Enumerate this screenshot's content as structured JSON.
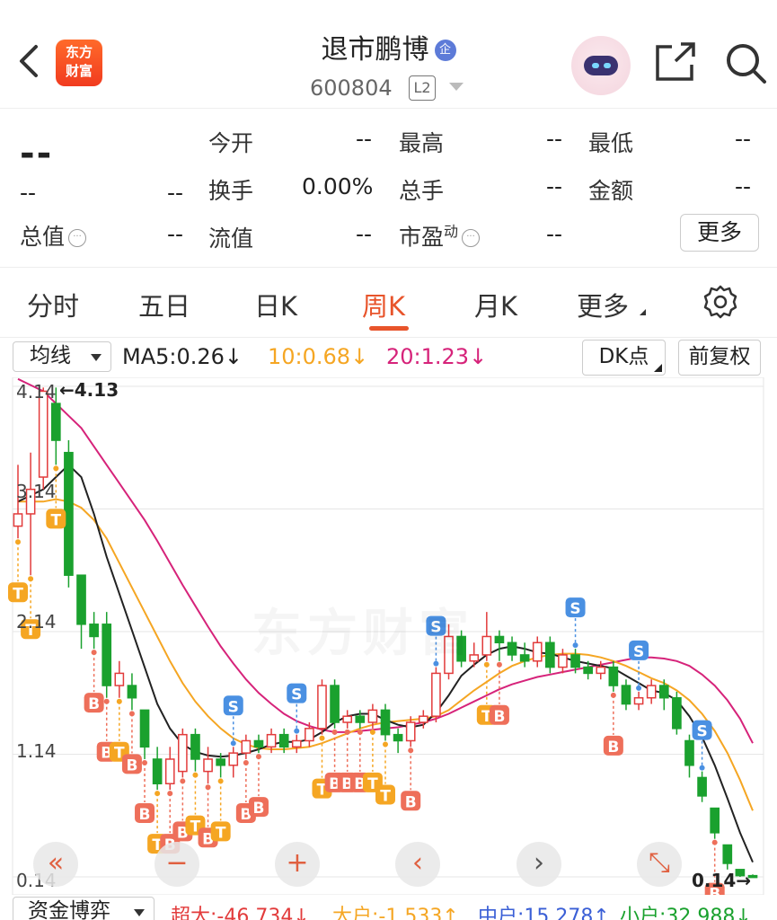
{
  "header": {
    "title": "退市鹏博",
    "title_badge": "企",
    "stock_code": "600804",
    "level_badge": "L2",
    "logo_line1": "东方",
    "logo_line2": "财富"
  },
  "quote": {
    "price": "--",
    "change": "--",
    "change_pct": "--",
    "rows": [
      [
        {
          "label": "今开",
          "value": "--"
        },
        {
          "label": "最高",
          "value": "--"
        },
        {
          "label": "最低",
          "value": "--"
        }
      ],
      [
        {
          "label": "换手",
          "value": "0.00%"
        },
        {
          "label": "总手",
          "value": "--"
        },
        {
          "label": "金额",
          "value": "--"
        }
      ],
      [
        {
          "label": "流值",
          "value": "--"
        },
        {
          "label": "市盈",
          "sup": "动",
          "value": "--"
        }
      ]
    ],
    "total_value_label": "总值",
    "total_value": "--",
    "more_label": "更多"
  },
  "tabs": [
    {
      "label": "分时",
      "active": false
    },
    {
      "label": "五日",
      "active": false
    },
    {
      "label": "日K",
      "active": false
    },
    {
      "label": "周K",
      "active": true
    },
    {
      "label": "月K",
      "active": false
    },
    {
      "label": "更多",
      "active": false
    }
  ],
  "indicator_bar": {
    "selector": "均线",
    "ma5": "MA5:0.26",
    "ma10": "10:0.68",
    "ma20": "20:1.23",
    "arrow": "↓",
    "dk_label": "DK点",
    "fq_label": "前复权",
    "colors": {
      "ma5": "#222222",
      "ma10": "#f5a623",
      "ma20": "#d6237a",
      "up": "#e23b3b",
      "down": "#1aa12e"
    }
  },
  "chart_data": {
    "type": "candlestick",
    "title": "",
    "y_ticks": [
      4.14,
      3.14,
      2.14,
      1.14,
      0.14
    ],
    "ylim": [
      0.14,
      4.14
    ],
    "max_label": "←4.13",
    "min_label": "0.14→",
    "watermark": "东方财富",
    "candles": [
      {
        "o": 3.0,
        "c": 3.1,
        "h": 3.5,
        "l": 2.9
      },
      {
        "o": 3.1,
        "c": 3.3,
        "h": 3.6,
        "l": 2.6
      },
      {
        "o": 3.4,
        "c": 4.1,
        "h": 4.13,
        "l": 3.3
      },
      {
        "o": 4.0,
        "c": 3.7,
        "h": 4.13,
        "l": 3.5
      },
      {
        "o": 3.6,
        "c": 2.6,
        "h": 3.7,
        "l": 2.5
      },
      {
        "o": 2.6,
        "c": 2.2,
        "h": 2.6,
        "l": 2.0
      },
      {
        "o": 2.2,
        "c": 2.1,
        "h": 2.3,
        "l": 2.0
      },
      {
        "o": 2.2,
        "c": 1.7,
        "h": 2.3,
        "l": 1.6
      },
      {
        "o": 1.7,
        "c": 1.8,
        "h": 1.9,
        "l": 1.6
      },
      {
        "o": 1.7,
        "c": 1.6,
        "h": 1.8,
        "l": 1.5
      },
      {
        "o": 1.5,
        "c": 1.2,
        "h": 1.5,
        "l": 1.1
      },
      {
        "o": 1.1,
        "c": 0.9,
        "h": 1.2,
        "l": 0.85
      },
      {
        "o": 0.9,
        "c": 1.1,
        "h": 1.2,
        "l": 0.85
      },
      {
        "o": 1.0,
        "c": 1.3,
        "h": 1.35,
        "l": 0.95
      },
      {
        "o": 1.3,
        "c": 1.1,
        "h": 1.35,
        "l": 1.0
      },
      {
        "o": 1.0,
        "c": 1.1,
        "h": 1.2,
        "l": 0.9
      },
      {
        "o": 1.1,
        "c": 1.05,
        "h": 1.15,
        "l": 0.95
      },
      {
        "o": 1.05,
        "c": 1.15,
        "h": 1.2,
        "l": 0.95
      },
      {
        "o": 1.15,
        "c": 1.25,
        "h": 1.3,
        "l": 1.1
      },
      {
        "o": 1.25,
        "c": 1.2,
        "h": 1.3,
        "l": 1.15
      },
      {
        "o": 1.2,
        "c": 1.3,
        "h": 1.35,
        "l": 1.15
      },
      {
        "o": 1.3,
        "c": 1.2,
        "h": 1.35,
        "l": 1.15
      },
      {
        "o": 1.2,
        "c": 1.25,
        "h": 1.3,
        "l": 1.15
      },
      {
        "o": 1.25,
        "c": 1.35,
        "h": 1.4,
        "l": 1.2
      },
      {
        "o": 1.35,
        "c": 1.7,
        "h": 1.75,
        "l": 1.3
      },
      {
        "o": 1.7,
        "c": 1.4,
        "h": 1.75,
        "l": 1.35
      },
      {
        "o": 1.4,
        "c": 1.45,
        "h": 1.5,
        "l": 1.35
      },
      {
        "o": 1.45,
        "c": 1.4,
        "h": 1.5,
        "l": 1.35
      },
      {
        "o": 1.4,
        "c": 1.5,
        "h": 1.55,
        "l": 1.35
      },
      {
        "o": 1.5,
        "c": 1.3,
        "h": 1.55,
        "l": 1.25
      },
      {
        "o": 1.3,
        "c": 1.25,
        "h": 1.35,
        "l": 1.15
      },
      {
        "o": 1.25,
        "c": 1.4,
        "h": 1.45,
        "l": 1.2
      },
      {
        "o": 1.4,
        "c": 1.45,
        "h": 1.5,
        "l": 1.35
      },
      {
        "o": 1.45,
        "c": 1.8,
        "h": 1.85,
        "l": 1.4
      },
      {
        "o": 1.8,
        "c": 2.1,
        "h": 2.2,
        "l": 1.75
      },
      {
        "o": 2.1,
        "c": 1.9,
        "h": 2.15,
        "l": 1.85
      },
      {
        "o": 1.9,
        "c": 1.95,
        "h": 2.05,
        "l": 1.85
      },
      {
        "o": 1.95,
        "c": 2.1,
        "h": 2.3,
        "l": 1.9
      },
      {
        "o": 2.1,
        "c": 2.05,
        "h": 2.15,
        "l": 1.9
      },
      {
        "o": 2.05,
        "c": 1.95,
        "h": 2.1,
        "l": 1.9
      },
      {
        "o": 1.95,
        "c": 1.9,
        "h": 2.05,
        "l": 1.85
      },
      {
        "o": 1.9,
        "c": 2.05,
        "h": 2.1,
        "l": 1.85
      },
      {
        "o": 2.05,
        "c": 1.85,
        "h": 2.1,
        "l": 1.8
      },
      {
        "o": 1.85,
        "c": 1.95,
        "h": 2.0,
        "l": 1.8
      },
      {
        "o": 1.95,
        "c": 1.85,
        "h": 2.0,
        "l": 1.8
      },
      {
        "o": 1.85,
        "c": 1.8,
        "h": 1.9,
        "l": 1.75
      },
      {
        "o": 1.8,
        "c": 1.85,
        "h": 1.9,
        "l": 1.75
      },
      {
        "o": 1.85,
        "c": 1.7,
        "h": 1.9,
        "l": 1.65
      },
      {
        "o": 1.7,
        "c": 1.55,
        "h": 1.75,
        "l": 1.5
      },
      {
        "o": 1.55,
        "c": 1.6,
        "h": 1.65,
        "l": 1.5
      },
      {
        "o": 1.6,
        "c": 1.7,
        "h": 1.75,
        "l": 1.55
      },
      {
        "o": 1.7,
        "c": 1.6,
        "h": 1.75,
        "l": 1.5
      },
      {
        "o": 1.6,
        "c": 1.35,
        "h": 1.65,
        "l": 1.3
      },
      {
        "o": 1.25,
        "c": 1.05,
        "h": 1.3,
        "l": 0.95
      },
      {
        "o": 0.95,
        "c": 0.8,
        "h": 1.0,
        "l": 0.75
      },
      {
        "o": 0.7,
        "c": 0.5,
        "h": 0.7,
        "l": 0.45
      },
      {
        "o": 0.4,
        "c": 0.25,
        "h": 0.4,
        "l": 0.2
      },
      {
        "o": 0.2,
        "c": 0.15,
        "h": 0.2,
        "l": 0.14
      },
      {
        "o": 0.15,
        "c": 0.14,
        "h": 0.16,
        "l": 0.14
      }
    ],
    "ma5": [
      3.2,
      3.25,
      3.3,
      3.4,
      3.5,
      3.4,
      3.1,
      2.75,
      2.45,
      2.15,
      1.85,
      1.55,
      1.35,
      1.22,
      1.16,
      1.13,
      1.12,
      1.13,
      1.15,
      1.18,
      1.22,
      1.24,
      1.24,
      1.26,
      1.32,
      1.4,
      1.45,
      1.47,
      1.47,
      1.42,
      1.38,
      1.36,
      1.38,
      1.48,
      1.62,
      1.78,
      1.87,
      1.95,
      2.0,
      2.02,
      2.0,
      1.97,
      1.96,
      1.93,
      1.9,
      1.88,
      1.86,
      1.84,
      1.78,
      1.72,
      1.66,
      1.64,
      1.58,
      1.45,
      1.28,
      1.05,
      0.78,
      0.5,
      0.26
    ],
    "ma10": [
      3.2,
      3.2,
      3.2,
      3.22,
      3.2,
      3.15,
      3.05,
      2.9,
      2.7,
      2.5,
      2.3,
      2.1,
      1.9,
      1.72,
      1.57,
      1.45,
      1.35,
      1.27,
      1.22,
      1.19,
      1.18,
      1.18,
      1.19,
      1.2,
      1.23,
      1.27,
      1.31,
      1.35,
      1.38,
      1.4,
      1.41,
      1.42,
      1.43,
      1.45,
      1.5,
      1.58,
      1.66,
      1.73,
      1.8,
      1.86,
      1.9,
      1.93,
      1.95,
      1.96,
      1.96,
      1.95,
      1.93,
      1.9,
      1.86,
      1.81,
      1.76,
      1.72,
      1.66,
      1.58,
      1.47,
      1.33,
      1.15,
      0.93,
      0.68
    ],
    "ma20": [
      4.2,
      4.15,
      4.1,
      4.0,
      3.9,
      3.8,
      3.65,
      3.5,
      3.35,
      3.2,
      3.05,
      2.88,
      2.7,
      2.52,
      2.35,
      2.18,
      2.02,
      1.88,
      1.75,
      1.64,
      1.55,
      1.47,
      1.41,
      1.37,
      1.34,
      1.32,
      1.32,
      1.33,
      1.34,
      1.35,
      1.36,
      1.38,
      1.4,
      1.43,
      1.47,
      1.52,
      1.57,
      1.62,
      1.67,
      1.71,
      1.74,
      1.77,
      1.79,
      1.81,
      1.83,
      1.85,
      1.87,
      1.89,
      1.91,
      1.93,
      1.93,
      1.92,
      1.9,
      1.86,
      1.79,
      1.7,
      1.58,
      1.43,
      1.23
    ],
    "signals": [
      {
        "i": 0,
        "t": "T"
      },
      {
        "i": 1,
        "t": "T"
      },
      {
        "i": 3,
        "t": "T"
      },
      {
        "i": 6,
        "t": "B"
      },
      {
        "i": 7,
        "t": "B"
      },
      {
        "i": 8,
        "t": "T"
      },
      {
        "i": 9,
        "t": "B"
      },
      {
        "i": 10,
        "t": "B"
      },
      {
        "i": 11,
        "t": "T"
      },
      {
        "i": 12,
        "t": "B"
      },
      {
        "i": 13,
        "t": "B"
      },
      {
        "i": 14,
        "t": "T"
      },
      {
        "i": 15,
        "t": "B"
      },
      {
        "i": 16,
        "t": "T"
      },
      {
        "i": 17,
        "t": "S"
      },
      {
        "i": 18,
        "t": "B"
      },
      {
        "i": 19,
        "t": "B"
      },
      {
        "i": 22,
        "t": "S"
      },
      {
        "i": 24,
        "t": "T"
      },
      {
        "i": 25,
        "t": "B"
      },
      {
        "i": 26,
        "t": "B"
      },
      {
        "i": 27,
        "t": "B"
      },
      {
        "i": 28,
        "t": "T"
      },
      {
        "i": 29,
        "t": "T"
      },
      {
        "i": 31,
        "t": "B"
      },
      {
        "i": 33,
        "t": "S"
      },
      {
        "i": 37,
        "t": "T"
      },
      {
        "i": 38,
        "t": "B"
      },
      {
        "i": 44,
        "t": "S"
      },
      {
        "i": 47,
        "t": "B"
      },
      {
        "i": 49,
        "t": "S"
      },
      {
        "i": 54,
        "t": "S"
      },
      {
        "i": 55,
        "t": "B"
      }
    ]
  },
  "nav_buttons": [
    "«",
    "−",
    "+",
    "‹",
    "›",
    "⤡"
  ],
  "footer": {
    "selector": "资金博弈",
    "items": [
      {
        "label": "超大:-46.734",
        "arrow": "↓",
        "color": "#e23b3b"
      },
      {
        "label": "大户:-1.533",
        "arrow": "↑",
        "color": "#f5a623"
      },
      {
        "label": "中户:15.278",
        "arrow": "↑",
        "color": "#3a5fd6"
      },
      {
        "label": "小户:32.988",
        "arrow": "↓",
        "color": "#1aa12e"
      }
    ]
  }
}
